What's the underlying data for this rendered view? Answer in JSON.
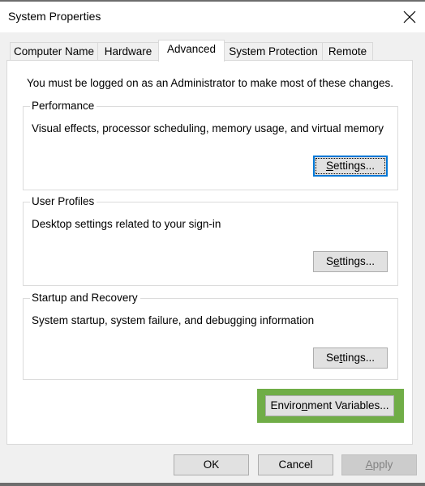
{
  "window": {
    "title": "System Properties",
    "close_icon": "close-icon"
  },
  "tabs": [
    {
      "label": "Computer Name",
      "active": false
    },
    {
      "label": "Hardware",
      "active": false
    },
    {
      "label": "Advanced",
      "active": true
    },
    {
      "label": "System Protection",
      "active": false
    },
    {
      "label": "Remote",
      "active": false
    }
  ],
  "advanced": {
    "admin_note": "You must be logged on as an Administrator to make most of these changes.",
    "groups": [
      {
        "title": "Performance",
        "description": "Visual effects, processor scheduling, memory usage, and virtual memory",
        "button": {
          "prefix": "",
          "mnemonic": "S",
          "suffix": "ettings...",
          "focused": true
        }
      },
      {
        "title": "User Profiles",
        "description": "Desktop settings related to your sign-in",
        "button": {
          "prefix": "S",
          "mnemonic": "e",
          "suffix": "ttings...",
          "focused": false
        }
      },
      {
        "title": "Startup and Recovery",
        "description": "System startup, system failure, and debugging information",
        "button": {
          "prefix": "Se",
          "mnemonic": "t",
          "suffix": "tings...",
          "focused": false
        }
      }
    ],
    "env_button": {
      "prefix": "Enviro",
      "mnemonic": "n",
      "suffix": "ment Variables...",
      "highlight_color": "#70ad47"
    }
  },
  "footer": {
    "ok_label": "OK",
    "cancel_label": "Cancel",
    "apply": {
      "prefix": "",
      "mnemonic": "A",
      "suffix": "pply",
      "disabled": true
    }
  },
  "colors": {
    "focus_border": "#0078d7",
    "highlight": "#70ad47"
  }
}
